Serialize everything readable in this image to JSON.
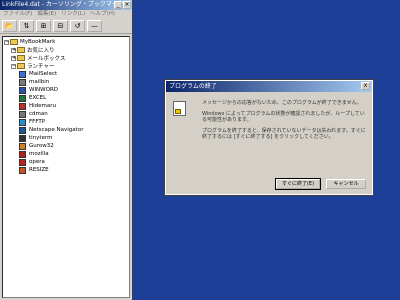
{
  "window": {
    "title": "LinkFile4.dat - カーソリング・ブックマーク",
    "menu": [
      "ファイル(F)",
      "編集(E)",
      "リンク(L)",
      "ヘルプ(H)"
    ],
    "toolbar": [
      "📂",
      "⇅",
      "⊞",
      "⊟",
      "↺",
      "—"
    ]
  },
  "tree": {
    "root": "MyBookMark",
    "folders": [
      "お気に入り",
      "メールボックス",
      "ランチャー"
    ],
    "items": [
      {
        "label": "MailSelect",
        "color": "#3a6fd8",
        "icon": "mail-icon"
      },
      {
        "label": "mailbin",
        "color": "#7a7a7a",
        "icon": "app-icon"
      },
      {
        "label": "WINWORD",
        "color": "#2a4fb0",
        "icon": "word-icon"
      },
      {
        "label": "EXCEL",
        "color": "#1e7a3a",
        "icon": "excel-icon"
      },
      {
        "label": "Hidemaru",
        "color": "#c03030",
        "icon": "app-icon"
      },
      {
        "label": "cdman",
        "color": "#777777",
        "icon": "app-icon"
      },
      {
        "label": "FFFTP",
        "color": "#2a8fd0",
        "icon": "ftp-icon"
      },
      {
        "label": "Netscape Navigator",
        "color": "#1a5a9a",
        "icon": "browser-icon"
      },
      {
        "label": "tinyterm",
        "color": "#333333",
        "icon": "terminal-icon"
      },
      {
        "label": "Gurow32",
        "color": "#d08020",
        "icon": "app-icon"
      },
      {
        "label": "mozilla",
        "color": "#b02020",
        "icon": "browser-icon"
      },
      {
        "label": "opera",
        "color": "#c02020",
        "icon": "browser-icon"
      },
      {
        "label": "RESIZE",
        "color": "#d05020",
        "icon": "app-icon"
      }
    ]
  },
  "dialog": {
    "title": "プログラムの終了",
    "close": "x",
    "paragraphs": [
      "メッセージからの応答がないため、このプログラムが終了できません。",
      "Windows によってプログラムの状態が確認されましたが、ループしている可能性があります。",
      "プログラムを終了すると、保存されていないデータは失われます。すぐに終了するには [すぐに終了する] をクリックしてください。"
    ],
    "buttons": {
      "end_now": "すぐに終了(E)",
      "cancel": "キャンセル"
    }
  }
}
